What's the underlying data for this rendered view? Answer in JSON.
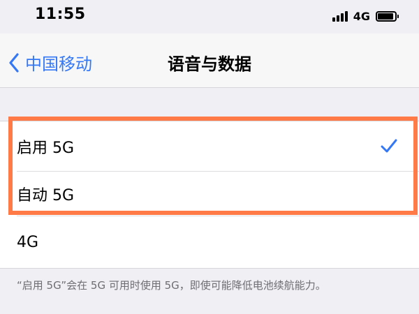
{
  "status_bar": {
    "time": "11:55",
    "network_type": "4G",
    "signal_icon": "cellular-signal-icon",
    "battery_icon": "battery-icon"
  },
  "nav": {
    "back_label": "中国移动",
    "back_icon": "chevron-left-icon",
    "title": "语音与数据"
  },
  "options": [
    {
      "label": "启用 5G",
      "selected": true
    },
    {
      "label": "自动 5G",
      "selected": false
    },
    {
      "label": "4G",
      "selected": false
    }
  ],
  "footnote": "“启用 5G”会在 5G 可用时使用 5G，即使可能降低电池续航能力。",
  "colors": {
    "accent": "#3478f6",
    "highlight": "#ff7a47",
    "background": "#efeff4",
    "footnote_text": "#6d6d72"
  }
}
